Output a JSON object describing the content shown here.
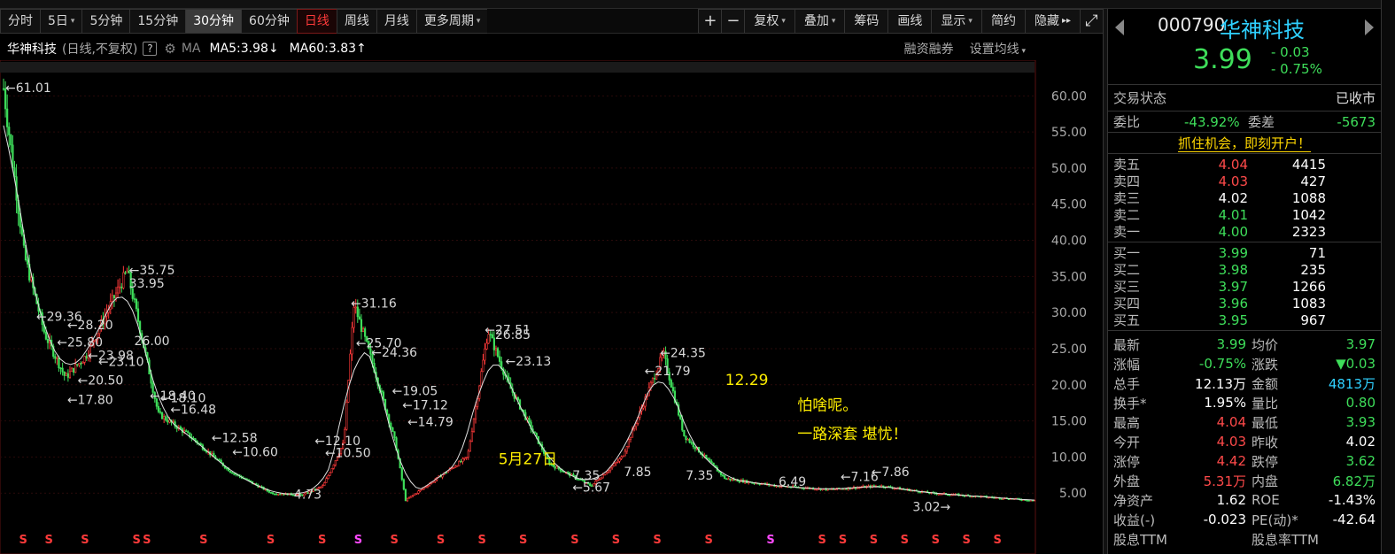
{
  "toolbar": {
    "periods": [
      {
        "label": "分时",
        "state": "normal",
        "caret": false
      },
      {
        "label": "5日",
        "state": "normal",
        "caret": true
      },
      {
        "label": "5分钟",
        "state": "normal",
        "caret": false
      },
      {
        "label": "15分钟",
        "state": "normal",
        "caret": false
      },
      {
        "label": "30分钟",
        "state": "gray",
        "caret": false
      },
      {
        "label": "60分钟",
        "state": "normal",
        "caret": false
      },
      {
        "label": "日线",
        "state": "red",
        "caret": false
      },
      {
        "label": "周线",
        "state": "normal",
        "caret": false
      },
      {
        "label": "月线",
        "state": "normal",
        "caret": false
      },
      {
        "label": "更多周期",
        "state": "normal",
        "caret": true
      }
    ],
    "tools": [
      {
        "label": "+",
        "icon": "zoom-in-icon",
        "caret": false
      },
      {
        "label": "−",
        "icon": "zoom-out-icon",
        "caret": false
      },
      {
        "label": "复权",
        "caret": true
      },
      {
        "label": "叠加",
        "caret": true
      },
      {
        "label": "筹码",
        "caret": false
      },
      {
        "label": "画线",
        "caret": false
      },
      {
        "label": "显示",
        "caret": true
      },
      {
        "label": "简约",
        "caret": false
      },
      {
        "label": "隐藏",
        "caret": false,
        "suffix": "▸▸"
      },
      {
        "label": "⤢",
        "icon": "fullscreen-icon",
        "caret": false
      }
    ]
  },
  "chart_header": {
    "stock_name": "华神科技",
    "mode": "(日线,不复权)",
    "help": "?",
    "ma_label": "MA",
    "ma5": "MA5:3.98",
    "ma5_arrow": "↓",
    "ma60": "MA60:3.83",
    "ma60_arrow": "↑",
    "margin_label": "融资融券",
    "settings_label": "设置均线"
  },
  "chart_data": {
    "type": "candlestick",
    "y_axis": {
      "min": 0,
      "max": 62,
      "ticks": [
        5,
        10,
        15,
        20,
        25,
        30,
        35,
        40,
        45,
        50,
        55,
        60
      ],
      "tick_labels": [
        "5.00",
        "10.00",
        "15.00",
        "20.00",
        "25.00",
        "30.00",
        "35.00",
        "40.00",
        "45.00",
        "50.00",
        "55.00",
        "60.00"
      ]
    },
    "price_path": [
      [
        0,
        61.01
      ],
      [
        0.02,
        38
      ],
      [
        0.04,
        27
      ],
      [
        0.06,
        21
      ],
      [
        0.08,
        24
      ],
      [
        0.1,
        30
      ],
      [
        0.12,
        35.75
      ],
      [
        0.135,
        26
      ],
      [
        0.15,
        16
      ],
      [
        0.18,
        13
      ],
      [
        0.22,
        8
      ],
      [
        0.26,
        5
      ],
      [
        0.29,
        4.73
      ],
      [
        0.31,
        6
      ],
      [
        0.33,
        12
      ],
      [
        0.34,
        31.16
      ],
      [
        0.36,
        22
      ],
      [
        0.38,
        12
      ],
      [
        0.39,
        4
      ],
      [
        0.42,
        7
      ],
      [
        0.45,
        10
      ],
      [
        0.47,
        27.51
      ],
      [
        0.49,
        20
      ],
      [
        0.53,
        9
      ],
      [
        0.57,
        6
      ],
      [
        0.6,
        10
      ],
      [
        0.64,
        24.35
      ],
      [
        0.66,
        13
      ],
      [
        0.7,
        7
      ],
      [
        0.75,
        6
      ],
      [
        0.8,
        5.5
      ],
      [
        0.85,
        6
      ],
      [
        0.9,
        5
      ],
      [
        0.95,
        4.5
      ],
      [
        1.0,
        3.99
      ]
    ],
    "max_price": "61.01",
    "min_price": "3.02",
    "price_labels": [
      {
        "text": "←61.01",
        "x": 0.0,
        "y": 61.01
      },
      {
        "text": "←35.75",
        "x": 0.12,
        "y": 35.75
      },
      {
        "text": "33.95",
        "x": 0.12,
        "y": 33.95
      },
      {
        "text": "←29.36",
        "x": 0.03,
        "y": 29.36
      },
      {
        "text": "←28.20",
        "x": 0.06,
        "y": 28.2
      },
      {
        "text": "←25.80",
        "x": 0.05,
        "y": 25.8
      },
      {
        "text": "←23.98",
        "x": 0.08,
        "y": 23.98
      },
      {
        "text": "←23.10",
        "x": 0.09,
        "y": 23.1
      },
      {
        "text": "26.00",
        "x": 0.125,
        "y": 26.0
      },
      {
        "text": "←20.50",
        "x": 0.07,
        "y": 20.5
      },
      {
        "text": "←18.40",
        "x": 0.14,
        "y": 18.4
      },
      {
        "text": "←18.10",
        "x": 0.15,
        "y": 18.1
      },
      {
        "text": "←16.48",
        "x": 0.16,
        "y": 16.48
      },
      {
        "text": "←17.80",
        "x": 0.06,
        "y": 17.8
      },
      {
        "text": "←12.58",
        "x": 0.2,
        "y": 12.58
      },
      {
        "text": "←10.60",
        "x": 0.22,
        "y": 10.6
      },
      {
        "text": "←31.16",
        "x": 0.335,
        "y": 31.16
      },
      {
        "text": "←25.70",
        "x": 0.34,
        "y": 25.7
      },
      {
        "text": "←24.36",
        "x": 0.355,
        "y": 24.36
      },
      {
        "text": "←19.05",
        "x": 0.375,
        "y": 19.05
      },
      {
        "text": "←17.12",
        "x": 0.385,
        "y": 17.12
      },
      {
        "text": "←14.79",
        "x": 0.39,
        "y": 14.79
      },
      {
        "text": "←12.10",
        "x": 0.3,
        "y": 12.1
      },
      {
        "text": "←10.50",
        "x": 0.31,
        "y": 10.5
      },
      {
        "text": "4.73",
        "x": 0.28,
        "y": 4.73
      },
      {
        "text": "←27.51",
        "x": 0.465,
        "y": 27.51
      },
      {
        "text": "26.85",
        "x": 0.475,
        "y": 26.85
      },
      {
        "text": "←23.13",
        "x": 0.485,
        "y": 23.13
      },
      {
        "text": "←24.35",
        "x": 0.635,
        "y": 24.35
      },
      {
        "text": "←21.79",
        "x": 0.62,
        "y": 21.79
      },
      {
        "text": "7.35",
        "x": 0.55,
        "y": 7.35
      },
      {
        "text": "←5.67",
        "x": 0.55,
        "y": 5.67
      },
      {
        "text": "7.85",
        "x": 0.6,
        "y": 7.85
      },
      {
        "text": "7.35",
        "x": 0.66,
        "y": 7.35
      },
      {
        "text": "←7.16",
        "x": 0.81,
        "y": 7.16
      },
      {
        "text": "←7.86",
        "x": 0.84,
        "y": 7.86
      },
      {
        "text": "6.49",
        "x": 0.75,
        "y": 6.49
      },
      {
        "text": "3.02→",
        "x": 0.88,
        "y": 3.02
      }
    ],
    "annotations": [
      {
        "text": "5月27日",
        "x": 0.48,
        "y": 9.0
      },
      {
        "text": "12.29",
        "x": 0.7,
        "y": 20.0
      },
      {
        "text": "一路深套 堪忧！",
        "x": 0.77,
        "y": 12.5
      },
      {
        "text": "怕啥呢。",
        "x": 0.77,
        "y": 16.5
      }
    ],
    "grid": true,
    "legend": "none"
  },
  "quote": {
    "code": "000790",
    "name": "华神科技",
    "price": "3.99",
    "change": "- 0.03",
    "change_pct": "- 0.75%",
    "trade_status_label": "交易状态",
    "trade_status": "已收市",
    "wb_label": "委比",
    "wb_value": "-43.92%",
    "wc_label": "委差",
    "wc_value": "-5673",
    "promo": "抓住机会，即刻开户！",
    "asks": [
      {
        "label": "卖五",
        "price": "4.04",
        "vol": "4415",
        "color": "red"
      },
      {
        "label": "卖四",
        "price": "4.03",
        "vol": "427",
        "color": "red"
      },
      {
        "label": "卖三",
        "price": "4.02",
        "vol": "1088",
        "color": "white"
      },
      {
        "label": "卖二",
        "price": "4.01",
        "vol": "1042",
        "color": "green"
      },
      {
        "label": "卖一",
        "price": "4.00",
        "vol": "2323",
        "color": "green"
      }
    ],
    "bids": [
      {
        "label": "买一",
        "price": "3.99",
        "vol": "71",
        "color": "green"
      },
      {
        "label": "买二",
        "price": "3.98",
        "vol": "235",
        "color": "green"
      },
      {
        "label": "买三",
        "price": "3.97",
        "vol": "1266",
        "color": "green"
      },
      {
        "label": "买四",
        "price": "3.96",
        "vol": "1083",
        "color": "green"
      },
      {
        "label": "买五",
        "price": "3.95",
        "vol": "967",
        "color": "green"
      }
    ],
    "stats": [
      {
        "l1": "最新",
        "v1": "3.99",
        "c1": "green",
        "l2": "均价",
        "v2": "3.97",
        "c2": "green"
      },
      {
        "l1": "涨幅",
        "v1": "-0.75%",
        "c1": "green",
        "l2": "涨跌",
        "v2": "▼0.03",
        "c2": "green"
      },
      {
        "l1": "总手",
        "v1": "12.13万",
        "c1": "white",
        "l2": "金额",
        "v2": "4813万",
        "c2": "cyan"
      },
      {
        "l1": "换手*",
        "v1": "1.95%",
        "c1": "white",
        "l2": "量比",
        "v2": "0.80",
        "c2": "green"
      },
      {
        "l1": "最高",
        "v1": "4.04",
        "c1": "red",
        "l2": "最低",
        "v2": "3.93",
        "c2": "green"
      },
      {
        "l1": "今开",
        "v1": "4.03",
        "c1": "red",
        "l2": "昨收",
        "v2": "4.02",
        "c2": "white"
      },
      {
        "l1": "涨停",
        "v1": "4.42",
        "c1": "red",
        "l2": "跌停",
        "v2": "3.62",
        "c2": "green"
      },
      {
        "l1": "外盘",
        "v1": "5.31万",
        "c1": "red",
        "l2": "内盘",
        "v2": "6.82万",
        "c2": "green"
      },
      {
        "l1": "净资产",
        "v1": "1.62",
        "c1": "white",
        "l2": "ROE",
        "v2": "-1.43%",
        "c2": "white"
      },
      {
        "l1": "收益(-)",
        "v1": "-0.023",
        "c1": "white",
        "l2": "PE(动)*",
        "v2": "-42.64",
        "c2": "white"
      },
      {
        "l1": "股息TTM",
        "v1": "",
        "c1": "white",
        "l2": "股息率TTM",
        "v2": "",
        "c2": "white"
      }
    ]
  },
  "colors": {
    "up": "#ff3a3a",
    "down": "#3ede5a",
    "grid": "#2a0a0a",
    "axis_text": "#aaaaaa",
    "annotation": "#ffee00"
  }
}
